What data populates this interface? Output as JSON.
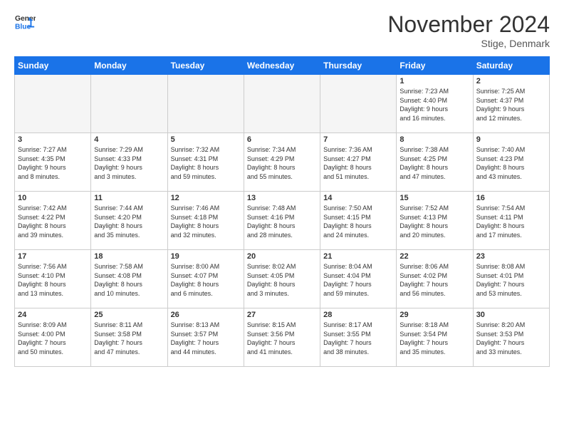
{
  "logo": {
    "line1": "General",
    "line2": "Blue"
  },
  "header": {
    "month": "November 2024",
    "location": "Stige, Denmark"
  },
  "weekdays": [
    "Sunday",
    "Monday",
    "Tuesday",
    "Wednesday",
    "Thursday",
    "Friday",
    "Saturday"
  ],
  "weeks": [
    [
      {
        "day": "",
        "info": ""
      },
      {
        "day": "",
        "info": ""
      },
      {
        "day": "",
        "info": ""
      },
      {
        "day": "",
        "info": ""
      },
      {
        "day": "",
        "info": ""
      },
      {
        "day": "1",
        "info": "Sunrise: 7:23 AM\nSunset: 4:40 PM\nDaylight: 9 hours\nand 16 minutes."
      },
      {
        "day": "2",
        "info": "Sunrise: 7:25 AM\nSunset: 4:37 PM\nDaylight: 9 hours\nand 12 minutes."
      }
    ],
    [
      {
        "day": "3",
        "info": "Sunrise: 7:27 AM\nSunset: 4:35 PM\nDaylight: 9 hours\nand 8 minutes."
      },
      {
        "day": "4",
        "info": "Sunrise: 7:29 AM\nSunset: 4:33 PM\nDaylight: 9 hours\nand 3 minutes."
      },
      {
        "day": "5",
        "info": "Sunrise: 7:32 AM\nSunset: 4:31 PM\nDaylight: 8 hours\nand 59 minutes."
      },
      {
        "day": "6",
        "info": "Sunrise: 7:34 AM\nSunset: 4:29 PM\nDaylight: 8 hours\nand 55 minutes."
      },
      {
        "day": "7",
        "info": "Sunrise: 7:36 AM\nSunset: 4:27 PM\nDaylight: 8 hours\nand 51 minutes."
      },
      {
        "day": "8",
        "info": "Sunrise: 7:38 AM\nSunset: 4:25 PM\nDaylight: 8 hours\nand 47 minutes."
      },
      {
        "day": "9",
        "info": "Sunrise: 7:40 AM\nSunset: 4:23 PM\nDaylight: 8 hours\nand 43 minutes."
      }
    ],
    [
      {
        "day": "10",
        "info": "Sunrise: 7:42 AM\nSunset: 4:22 PM\nDaylight: 8 hours\nand 39 minutes."
      },
      {
        "day": "11",
        "info": "Sunrise: 7:44 AM\nSunset: 4:20 PM\nDaylight: 8 hours\nand 35 minutes."
      },
      {
        "day": "12",
        "info": "Sunrise: 7:46 AM\nSunset: 4:18 PM\nDaylight: 8 hours\nand 32 minutes."
      },
      {
        "day": "13",
        "info": "Sunrise: 7:48 AM\nSunset: 4:16 PM\nDaylight: 8 hours\nand 28 minutes."
      },
      {
        "day": "14",
        "info": "Sunrise: 7:50 AM\nSunset: 4:15 PM\nDaylight: 8 hours\nand 24 minutes."
      },
      {
        "day": "15",
        "info": "Sunrise: 7:52 AM\nSunset: 4:13 PM\nDaylight: 8 hours\nand 20 minutes."
      },
      {
        "day": "16",
        "info": "Sunrise: 7:54 AM\nSunset: 4:11 PM\nDaylight: 8 hours\nand 17 minutes."
      }
    ],
    [
      {
        "day": "17",
        "info": "Sunrise: 7:56 AM\nSunset: 4:10 PM\nDaylight: 8 hours\nand 13 minutes."
      },
      {
        "day": "18",
        "info": "Sunrise: 7:58 AM\nSunset: 4:08 PM\nDaylight: 8 hours\nand 10 minutes."
      },
      {
        "day": "19",
        "info": "Sunrise: 8:00 AM\nSunset: 4:07 PM\nDaylight: 8 hours\nand 6 minutes."
      },
      {
        "day": "20",
        "info": "Sunrise: 8:02 AM\nSunset: 4:05 PM\nDaylight: 8 hours\nand 3 minutes."
      },
      {
        "day": "21",
        "info": "Sunrise: 8:04 AM\nSunset: 4:04 PM\nDaylight: 7 hours\nand 59 minutes."
      },
      {
        "day": "22",
        "info": "Sunrise: 8:06 AM\nSunset: 4:02 PM\nDaylight: 7 hours\nand 56 minutes."
      },
      {
        "day": "23",
        "info": "Sunrise: 8:08 AM\nSunset: 4:01 PM\nDaylight: 7 hours\nand 53 minutes."
      }
    ],
    [
      {
        "day": "24",
        "info": "Sunrise: 8:09 AM\nSunset: 4:00 PM\nDaylight: 7 hours\nand 50 minutes."
      },
      {
        "day": "25",
        "info": "Sunrise: 8:11 AM\nSunset: 3:58 PM\nDaylight: 7 hours\nand 47 minutes."
      },
      {
        "day": "26",
        "info": "Sunrise: 8:13 AM\nSunset: 3:57 PM\nDaylight: 7 hours\nand 44 minutes."
      },
      {
        "day": "27",
        "info": "Sunrise: 8:15 AM\nSunset: 3:56 PM\nDaylight: 7 hours\nand 41 minutes."
      },
      {
        "day": "28",
        "info": "Sunrise: 8:17 AM\nSunset: 3:55 PM\nDaylight: 7 hours\nand 38 minutes."
      },
      {
        "day": "29",
        "info": "Sunrise: 8:18 AM\nSunset: 3:54 PM\nDaylight: 7 hours\nand 35 minutes."
      },
      {
        "day": "30",
        "info": "Sunrise: 8:20 AM\nSunset: 3:53 PM\nDaylight: 7 hours\nand 33 minutes."
      }
    ]
  ]
}
